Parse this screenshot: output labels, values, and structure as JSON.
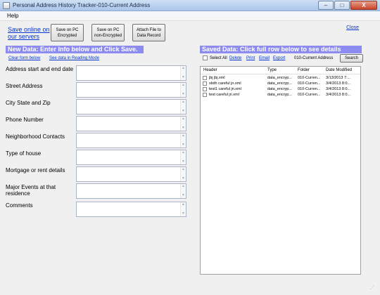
{
  "window": {
    "title": "Personal Address History Tracker-010-Current Address",
    "buttons": {
      "minimize": "–",
      "maximize": "□",
      "close": "X"
    }
  },
  "menu": {
    "help": "Help"
  },
  "toolbar": {
    "save_online": "Save online on our servers",
    "save_encrypted": "Save on PC Encrypted",
    "save_non_encrypted": "Save on PC non-Encrypted",
    "attach_file": "Attach File to Data Record",
    "close": "Close"
  },
  "left": {
    "banner": "New Data: Enter Info below and Click Save.",
    "clear_form": "Clear form below",
    "reading_mode": "See data in Reading Mode",
    "fields": [
      {
        "label": "Address start and end date",
        "value": ""
      },
      {
        "label": "Street Address",
        "value": ""
      },
      {
        "label": "City State and Zip",
        "value": ""
      },
      {
        "label": "Phone Number",
        "value": ""
      },
      {
        "label": "Neighborhood Contacts",
        "value": ""
      },
      {
        "label": "Type of house",
        "value": ""
      },
      {
        "label": "Mortgage or rent details",
        "value": ""
      },
      {
        "label": "Major Events at that residence",
        "value": ""
      },
      {
        "label": "Comments",
        "value": ""
      }
    ]
  },
  "right": {
    "banner": "Saved Data: Click full row below to see details",
    "select_all": "Select All",
    "delete": "Delete",
    "print": "Print",
    "email": "Email",
    "export": "Export",
    "folder": "010-Current Address",
    "search": "Search",
    "columns": [
      "Header",
      "Type",
      "Folder",
      "Date Modified"
    ],
    "rows": [
      {
        "header": "jbj jbj.xml",
        "type": "data_encryp...",
        "folder": "010-Curren...",
        "date": "3/13/2013 7:..."
      },
      {
        "header": "sloth careful jn.xml",
        "type": "data_encryp...",
        "folder": "010-Curren...",
        "date": "3/4/2013 8:0..."
      },
      {
        "header": "test1 careful jn.xml",
        "type": "data_encryp...",
        "folder": "010-Curren...",
        "date": "3/4/2013 8:0..."
      },
      {
        "header": "test careful jn.xml",
        "type": "data_encryp...",
        "folder": "010-Curren...",
        "date": "3/4/2013 8:0..."
      }
    ]
  }
}
